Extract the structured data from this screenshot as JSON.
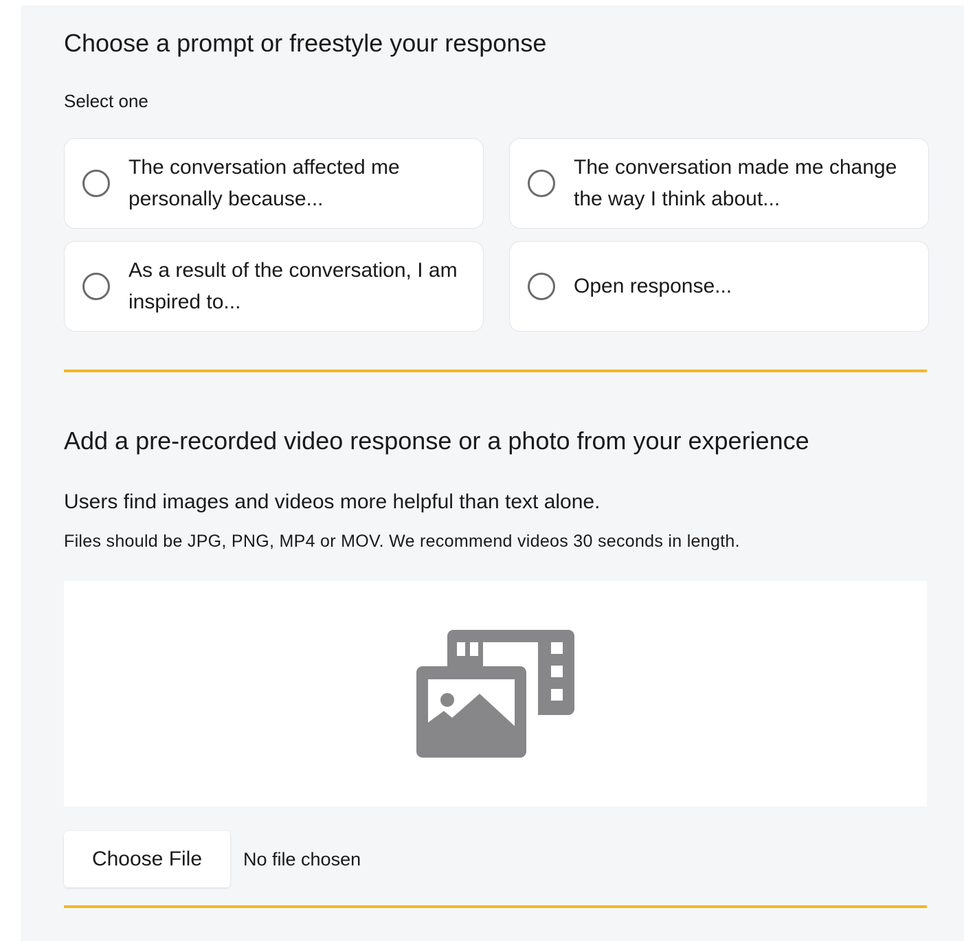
{
  "prompt_section": {
    "title": "Choose a prompt or freestyle your response",
    "select_label": "Select one",
    "options": [
      {
        "label": "The conversation affected me personally because..."
      },
      {
        "label": "The conversation made me change the way I think about..."
      },
      {
        "label": "As a result of the conversation, I am inspired to..."
      },
      {
        "label": "Open response..."
      }
    ]
  },
  "media_section": {
    "title": "Add a pre-recorded video response or a photo from your experience",
    "helper_text": "Users find images and videos more helpful than text alone.",
    "file_requirements": "Files should be JPG, PNG, MP4 or MOV. We recommend videos 30 seconds in length.",
    "dropzone_icon": "photo-video-icon",
    "choose_file_label": "Choose File",
    "file_status": "No file chosen"
  },
  "colors": {
    "accent_divider": "#f2b824",
    "panel_background": "#f5f6f8",
    "icon_gray": "#87878a"
  }
}
